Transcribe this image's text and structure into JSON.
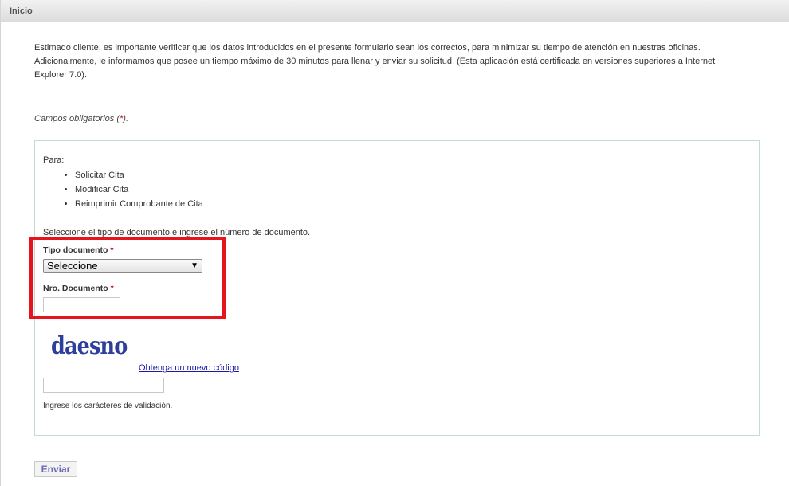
{
  "header": {
    "title": "Inicio"
  },
  "intro": {
    "text": "Estimado cliente, es importante verificar que los datos introducidos en el presente formulario sean los correctos, para minimizar su tiempo de atención en nuestras oficinas. Adicionalmente, le informamos que posee un tiempo máximo de 30 minutos para llenar y enviar su solicitud. (Esta aplicación está certificada en versiones superiores a Internet Explorer 7.0)."
  },
  "required_note": {
    "prefix": "Campos obligatorios (",
    "star": "*",
    "suffix": ")."
  },
  "form": {
    "para_label": "Para:",
    "options": [
      "Solicitar Cita",
      "Modificar Cita",
      "Reimprimir Comprobante de Cita"
    ],
    "instructions": "Seleccione el tipo de documento e ingrese el número de documento.",
    "tipo_documento": {
      "label": "Tipo documento",
      "required_mark": "*",
      "selected": "Seleccione",
      "arrow": "▼"
    },
    "nro_documento": {
      "label": "Nro. Documento",
      "required_mark": "*",
      "value": ""
    },
    "captcha": {
      "text": "daesno",
      "new_code_link": "Obtenga un nuevo código",
      "input_value": "",
      "help": "Ingrese los carácteres de validación."
    }
  },
  "submit": {
    "label": "Enviar"
  },
  "colors": {
    "highlight": "#e8141d",
    "required": "#cc0000",
    "link": "#1a1aa6",
    "box_border": "#c4dcd6"
  }
}
